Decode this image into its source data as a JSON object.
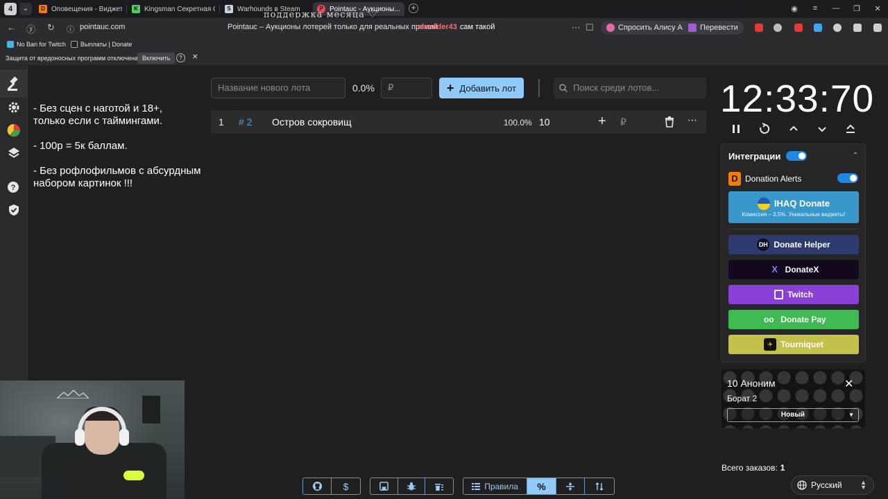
{
  "browser": {
    "tab_count": "4",
    "tabs": [
      {
        "label": "Оповещения - Виджеты",
        "color": "#f57d07",
        "glyph": "D"
      },
      {
        "label": "Kingsman Секретная Слу",
        "color": "#46d160",
        "glyph": "K"
      },
      {
        "label": "Warhounds в Steam",
        "color": "#1b2838",
        "glyph": "S"
      },
      {
        "label": "Pointauc - Аукционы...",
        "color": "#e84a5f",
        "glyph": "P"
      }
    ],
    "overlay_text": "поддержка месяца ♡",
    "url": "pointauc.com",
    "page_title": "Pointauc – Аукционы лотерей только для реальных премий",
    "chat_nick": "alexeder43",
    "chat_text": "сам такой",
    "alice_label": "Спросить Алису AI",
    "translate_label": "Перевести",
    "bookmarks": [
      {
        "label": "No Ban for Twitch",
        "color": "#46b4e0"
      },
      {
        "label": "Выплаты | Donate",
        "color": "#222222"
      }
    ],
    "warning_text": "Защита от вредоносных программ отключена",
    "warning_enable": "Включить"
  },
  "app": {
    "notes": "- Без сцен с наготой и 18+,\nтолько если с таймингами.\n\n- 100р = 5к баллам.\n\n- Без рофлофильмов с абсурдным набором картинок !!!",
    "new_lot_placeholder": "Название нового лота",
    "percent": "0.0%",
    "amount_placeholder": "₽",
    "add_lot_label": "Добавить лот",
    "search_placeholder": "Поиск среди лотов...",
    "lot": {
      "index": "1",
      "id": "# 2",
      "name": "Остров сокровищ",
      "percent": "100.0%",
      "amount": "10",
      "currency": "₽"
    },
    "timer": "12:33:70",
    "integrations": {
      "title": "Интеграции",
      "donation_alerts": "Donation Alerts",
      "ihaq_title": "IHAQ Donate",
      "ihaq_sub": "Комиссия – 3,5%. Уникальные виджеты!",
      "providers": [
        {
          "label": "Donate Helper",
          "color": "#2c3a6e",
          "icon": "DH"
        },
        {
          "label": "DonateX",
          "color": "#14081e",
          "icon": "X"
        },
        {
          "label": "Twitch",
          "color": "#8a3fd6",
          "icon": "T"
        },
        {
          "label": "Donate Pay",
          "color": "#3fba52",
          "icon": "oo"
        },
        {
          "label": "Tourniquet",
          "color": "#c4c14a",
          "icon": "✈"
        }
      ]
    },
    "donation": {
      "title": "10 Аноним",
      "message": "Борат 2",
      "select_value": "Новый"
    },
    "total_label": "Всего заказов:",
    "total_value": "1",
    "language": "Русский",
    "rules_label": "Правила"
  }
}
